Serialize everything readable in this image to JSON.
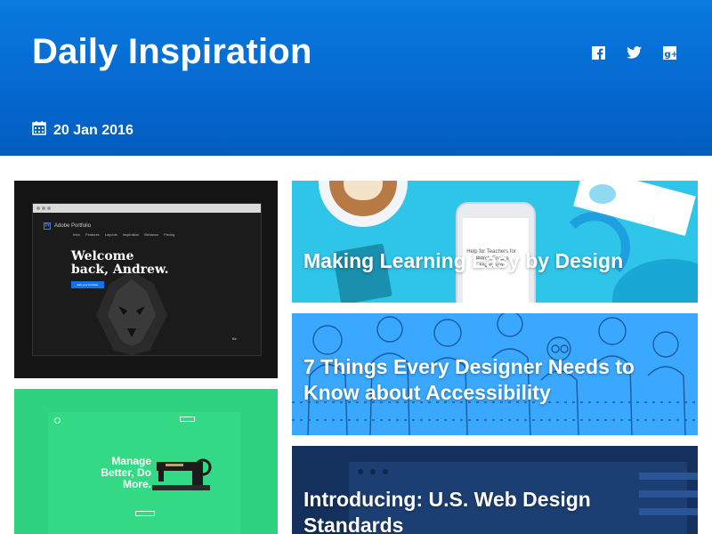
{
  "header": {
    "title": "Daily Inspiration",
    "date": "20 Jan 2016",
    "social_icons": [
      "facebook-icon",
      "twitter-icon",
      "google-plus-icon"
    ]
  },
  "cards": [
    {
      "name": "adobe-portfolio",
      "title": "",
      "mock": {
        "app_name": "Adobe Portfolio",
        "nav": [
          "Intro",
          "Features",
          "Layouts",
          "Inspiration",
          "Behance",
          "Pricing"
        ],
        "welcome": "Welcome back, Andrew.",
        "button": "Edit your Portfolio",
        "badge": "Be"
      }
    },
    {
      "name": "making-learning-easy",
      "title": "Making Learning Easy by Design",
      "mock": {
        "phone_text": "Help for Teachers for Search Engine Marketing"
      }
    },
    {
      "name": "accessibility",
      "title": "7 Things Every Designer Needs to Know about Accessibility"
    },
    {
      "name": "manage-better",
      "title": "",
      "mock": {
        "headline": "Manage Better, Do More."
      }
    },
    {
      "name": "us-web-design",
      "title": "Introducing: U.S. Web Design Standards"
    }
  ],
  "colors": {
    "header_top": "#0a7be0",
    "header_bottom": "#035dbf",
    "card_cyan": "#2ec5e8",
    "card_blue": "#3aa8ff",
    "card_green": "#2fd27f",
    "card_navy": "#14305c"
  }
}
